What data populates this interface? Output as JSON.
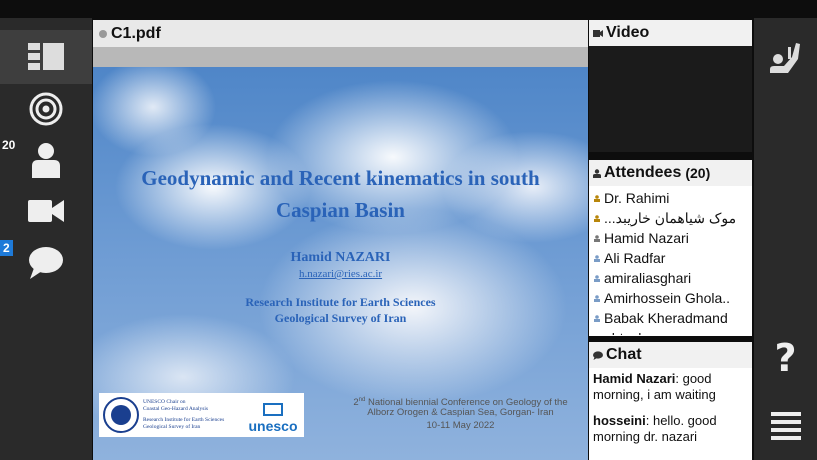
{
  "document": {
    "title": "C1.pdf",
    "slide": {
      "title_line1": "Geodynamic and Recent kinematics in south",
      "title_line2": "Caspian Basin",
      "author": "Hamid  NAZARI",
      "email": "h.nazari@ries.ac.ir",
      "institute_line1": "Research Institute for Earth Sciences",
      "institute_line2": "Geological Survey of Iran",
      "logo_text_line1": "UNESCO Chair on",
      "logo_text_line2": "Coastal Geo-Hazard Analysis",
      "logo_text_line3": "Research Institute for Earth Sciences",
      "logo_text_line4": "Geological Survey of Iran",
      "unesco_label": "unesco",
      "conference_line1_sup": "nd",
      "conference_line1_num": "2",
      "conference_line1_rest": " National biennial Conference on Geology of the",
      "conference_line2": "Alborz Orogen & Caspian Sea, Gorgan- Iran",
      "conference_line3": "10-11 May 2022"
    }
  },
  "left_rail": {
    "attendee_count_badge": "20",
    "chat_badge": "2"
  },
  "video": {
    "title": "Video"
  },
  "attendees": {
    "title": "Attendees",
    "count": "(20)",
    "items": [
      "Dr. Rahimi",
      "...موک شیاهمان خاریبد",
      "Hamid Nazari",
      "Ali Radfar",
      "amiraliasghari",
      "Amirhossein Ghola..",
      "Babak Kheradmand",
      "ahtesham"
    ]
  },
  "chat": {
    "title": "Chat",
    "messages": [
      {
        "sender": "Hamid Nazari",
        "text": ": good morning, i am waiting"
      },
      {
        "sender": "hosseini",
        "text": ": hello. good morning dr. nazari"
      }
    ]
  },
  "colors": {
    "slide_text": "#2a63b8",
    "rail_bg": "#2a2a2a",
    "badge_blue": "#1e7ad8"
  }
}
